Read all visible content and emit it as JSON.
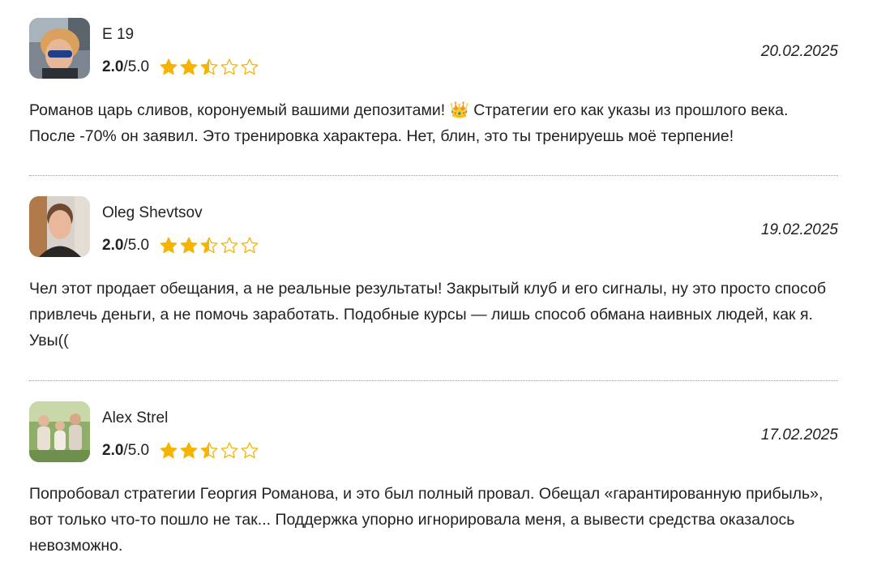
{
  "colors": {
    "star": "#f6b300",
    "text": "#222222",
    "divider": "#9a9a9a"
  },
  "reviews": [
    {
      "author": "Е 19",
      "score": "2.0",
      "scale": "/5.0",
      "stars": 2.5,
      "date": "20.02.2025",
      "avatar_icon": "man-in-car-sunglasses",
      "text": "Романов царь сливов, коронуемый вашими депозитами! 👑 Стратегии его как указы из прошлого века. После -70% он заявил. Это тренировка характера. Нет, блин, это ты тренируешь моё терпение!"
    },
    {
      "author": "Oleg Shevtsov",
      "score": "2.0",
      "scale": "/5.0",
      "stars": 2.5,
      "date": "19.02.2025",
      "avatar_icon": "man-portrait",
      "text": "Чел этот продает обещания, а не реальные результаты! Закрытый клуб и его сигналы, ну это просто способ привлечь деньги, а не помочь заработать. Подобные курсы — лишь способ обмана наивных людей, как я. Увы(("
    },
    {
      "author": "Alex Strel",
      "score": "2.0",
      "scale": "/5.0",
      "stars": 2.5,
      "date": "17.02.2025",
      "avatar_icon": "family-photo",
      "text": "Попробовал стратегии Георгия Романова, и это был полный провал. Обещал «гарантированную прибыль», вот только что-то пошло не так... Поддержка упорно игнорировала меня, а вывести средства оказалось невозможно."
    }
  ]
}
